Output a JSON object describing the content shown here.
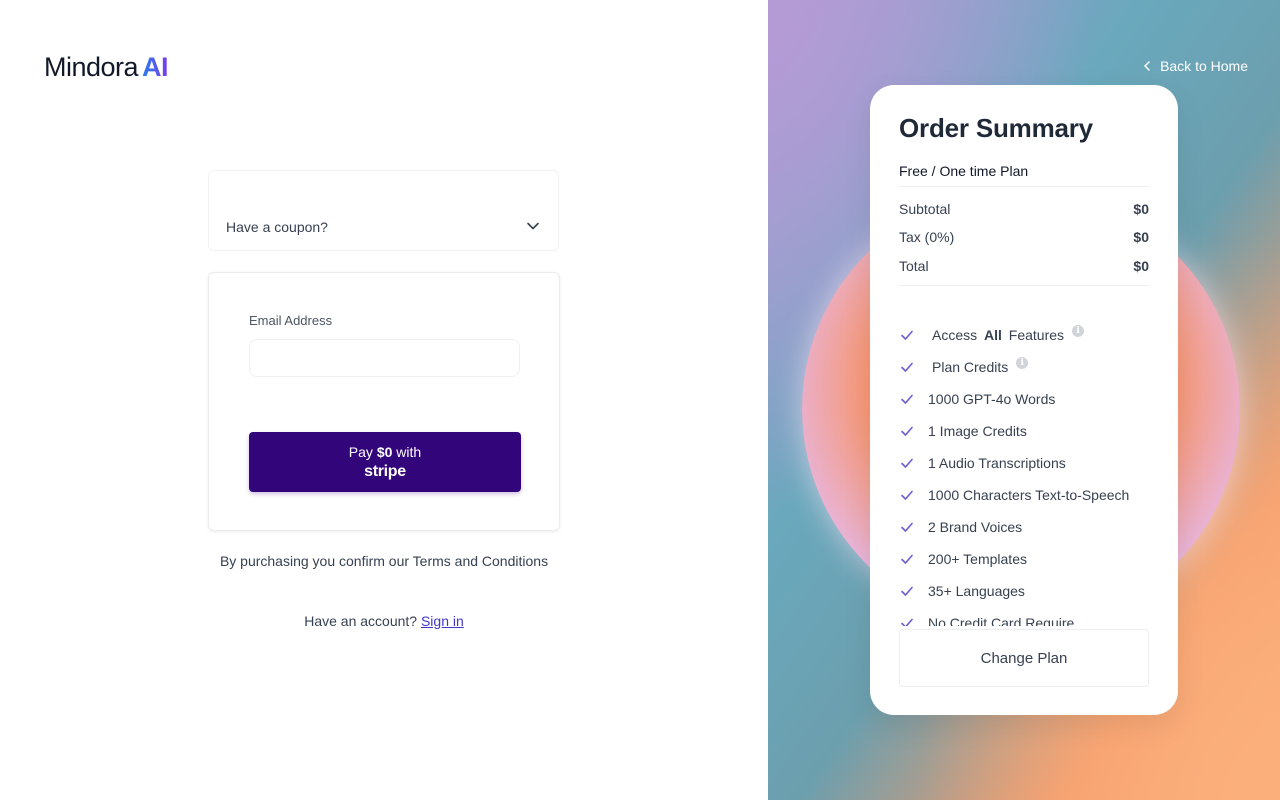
{
  "brand": {
    "name": "Mindora",
    "suffix": "AI"
  },
  "coupon": {
    "label": "Have a coupon?"
  },
  "form": {
    "email_label": "Email Address",
    "email_value": "",
    "pay_prefix": "Pay ",
    "pay_amount": "$0",
    "pay_suffix": " with",
    "pay_provider": "stripe"
  },
  "terms": {
    "text": "By purchasing you confirm our Terms and Conditions"
  },
  "account": {
    "prompt": "Have an account? ",
    "link": "Sign in"
  },
  "nav": {
    "back_label": "Back to Home"
  },
  "summary": {
    "title": "Order Summary",
    "plan": "Free / One time Plan",
    "subtotal_label": "Subtotal",
    "subtotal_value": "$0",
    "tax_label": "Tax (0%)",
    "tax_value": "$0",
    "total_label": "Total",
    "total_value": "$0",
    "features": [
      {
        "pre": "Access ",
        "bold": "All",
        "post": " Features"
      },
      {
        "text": "Plan Credits"
      },
      {
        "text": "1000 GPT-4o Words"
      },
      {
        "text": "1 Image Credits"
      },
      {
        "text": "1 Audio Transcriptions"
      },
      {
        "text": "1000 Characters Text-to-Speech"
      },
      {
        "text": "2 Brand Voices"
      },
      {
        "text": "200+ Templates"
      },
      {
        "text": "35+ Languages"
      },
      {
        "text": "No Credit Card Require"
      }
    ],
    "change_plan": "Change Plan"
  },
  "colors": {
    "primary": "#32067a",
    "check": "#6d5bd0",
    "link": "#4338ca"
  },
  "icons": {
    "chevron": "chevron-down-icon",
    "back": "chevron-left-icon",
    "check": "check-icon",
    "info": "info-icon"
  }
}
